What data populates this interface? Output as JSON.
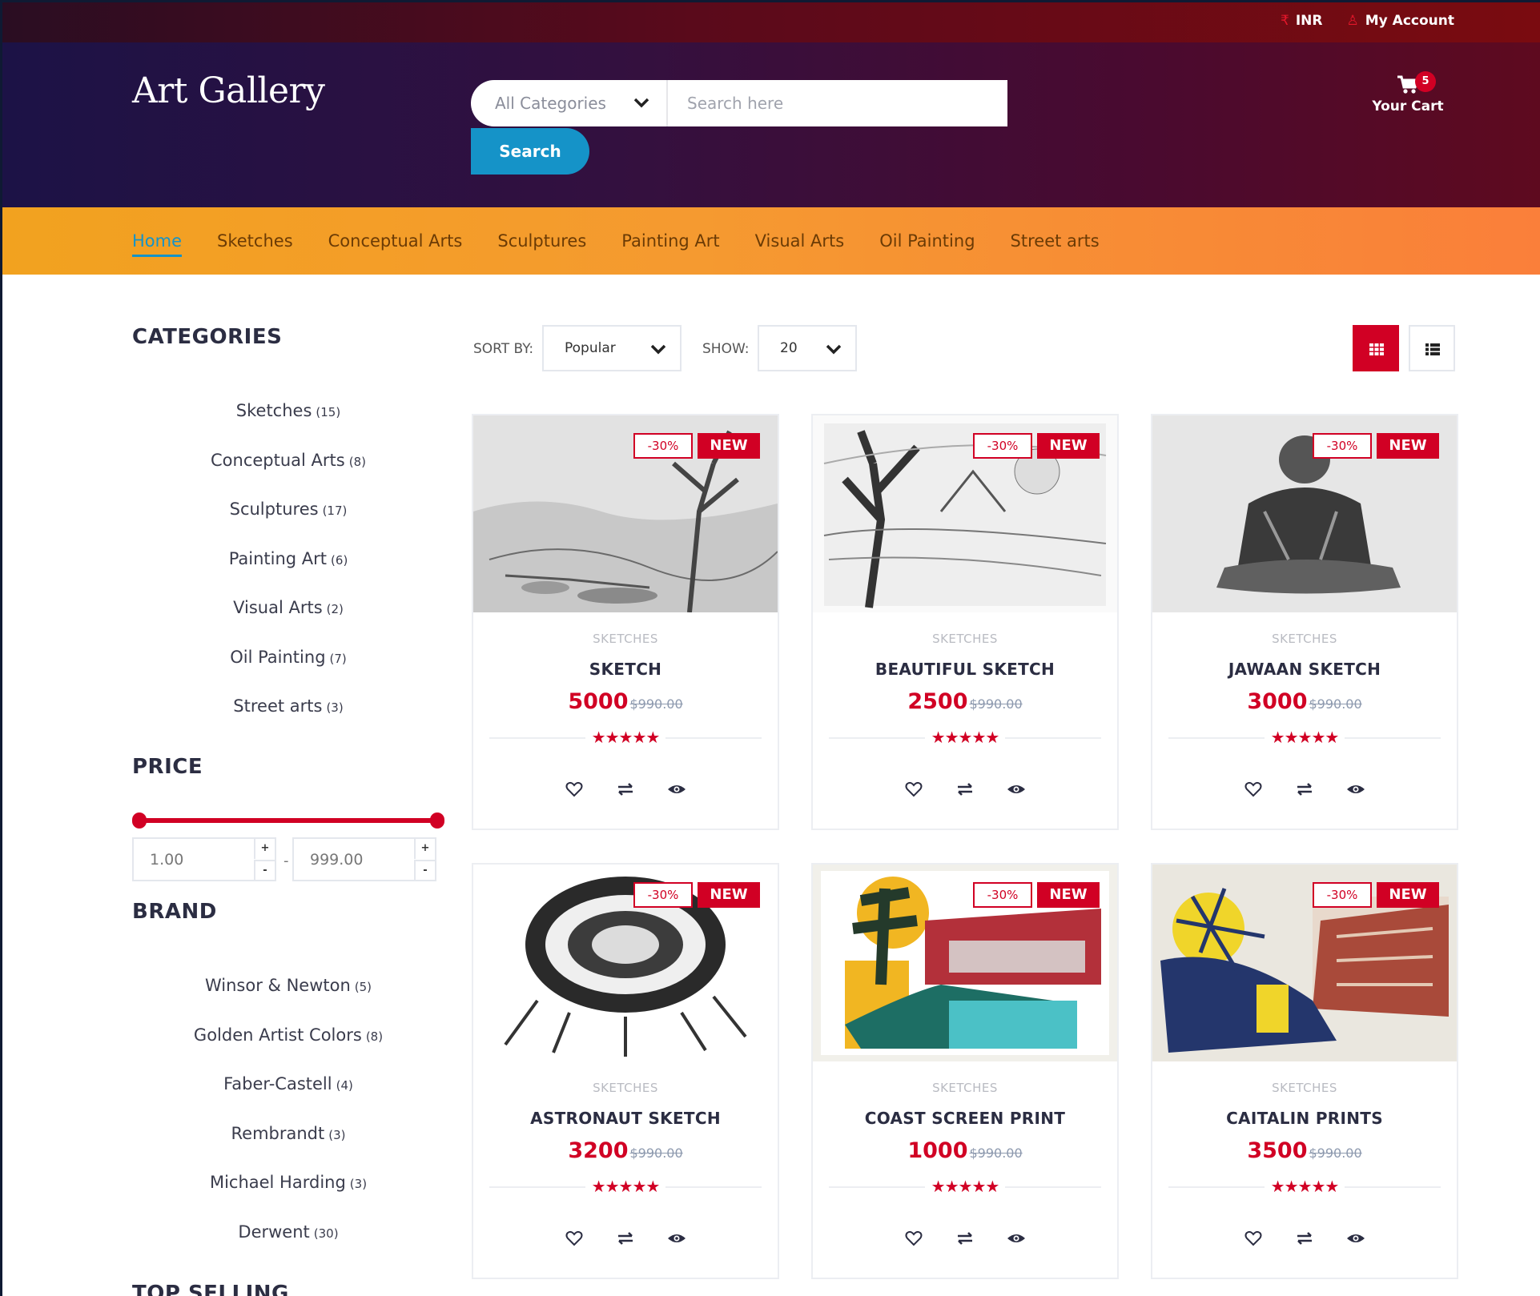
{
  "top_bar": {
    "currency_label": "INR",
    "account_label": "My Account"
  },
  "header": {
    "logo": "Art Gallery",
    "category_select": "All Categories",
    "search_placeholder": "Search here",
    "search_button": "Search",
    "cart_label": "Your Cart",
    "cart_count": "5"
  },
  "nav": {
    "items": [
      "Home",
      "Sketches",
      "Conceptual Arts",
      "Sculptures",
      "Painting Art",
      "Visual Arts",
      "Oil Painting",
      "Street arts"
    ],
    "active_index": 0
  },
  "sidebar": {
    "categories_title": "CATEGORIES",
    "categories": [
      {
        "label": "Sketches",
        "count": "(15)"
      },
      {
        "label": "Conceptual Arts",
        "count": "(8)"
      },
      {
        "label": "Sculptures",
        "count": "(17)"
      },
      {
        "label": "Painting Art",
        "count": "(6)"
      },
      {
        "label": "Visual Arts",
        "count": "(2)"
      },
      {
        "label": "Oil Painting",
        "count": "(7)"
      },
      {
        "label": "Street arts",
        "count": "(3)"
      }
    ],
    "price_title": "PRICE",
    "price_min": "1.00",
    "price_max": "999.00",
    "price_dash": "-",
    "stepper_up": "+",
    "stepper_down": "-",
    "brand_title": "BRAND",
    "brands": [
      {
        "label": "Winsor & Newton",
        "count": "(5)"
      },
      {
        "label": "Golden Artist Colors",
        "count": "(8)"
      },
      {
        "label": "Faber-Castell",
        "count": "(4)"
      },
      {
        "label": "Rembrandt",
        "count": "(3)"
      },
      {
        "label": "Michael Harding",
        "count": "(3)"
      },
      {
        "label": "Derwent",
        "count": "(30)"
      }
    ],
    "top_selling_title": "TOP SELLING"
  },
  "toolbar": {
    "sort_label": "SORT BY:",
    "sort_value": "Popular",
    "show_label": "SHOW:",
    "show_value": "20"
  },
  "products": [
    {
      "category": "SKETCHES",
      "name": "SKETCH",
      "price": "5000",
      "old_price": "$990.00",
      "sale": "-30%",
      "new": "NEW",
      "stars": "★★★★★"
    },
    {
      "category": "SKETCHES",
      "name": "BEAUTIFUL SKETCH",
      "price": "2500",
      "old_price": "$990.00",
      "sale": "-30%",
      "new": "NEW",
      "stars": "★★★★★"
    },
    {
      "category": "SKETCHES",
      "name": "JAWAAN SKETCH",
      "price": "3000",
      "old_price": "$990.00",
      "sale": "-30%",
      "new": "NEW",
      "stars": "★★★★★"
    },
    {
      "category": "SKETCHES",
      "name": "ASTRONAUT SKETCH",
      "price": "3200",
      "old_price": "$990.00",
      "sale": "-30%",
      "new": "NEW",
      "stars": "★★★★★"
    },
    {
      "category": "SKETCHES",
      "name": "COAST SCREEN PRINT",
      "price": "1000",
      "old_price": "$990.00",
      "sale": "-30%",
      "new": "NEW",
      "stars": "★★★★★"
    },
    {
      "category": "SKETCHES",
      "name": "CAITALIN PRINTS",
      "price": "3500",
      "old_price": "$990.00",
      "sale": "-30%",
      "new": "NEW",
      "stars": "★★★★★"
    }
  ],
  "colors": {
    "accent": "#d10024",
    "link": "#1593c8",
    "nav_gradient_start": "#f2a21f",
    "nav_gradient_end": "#fa7f3a"
  },
  "icons": {
    "currency": "rupee-icon",
    "account": "user-icon",
    "cart": "cart-icon",
    "wishlist": "heart-icon",
    "compare": "exchange-icon",
    "quick_view": "eye-icon",
    "grid_view": "grid-icon",
    "list_view": "list-icon"
  }
}
